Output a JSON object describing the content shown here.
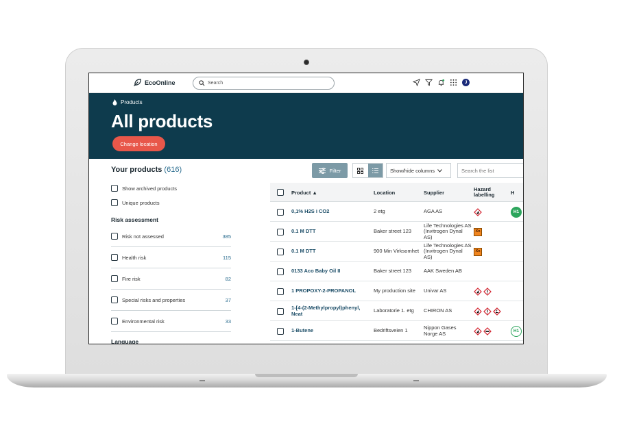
{
  "app": {
    "brand": "EcoOnline",
    "search_placeholder": "Search",
    "avatar_initial": "J"
  },
  "hero": {
    "breadcrumb": "Products",
    "title": "All products",
    "change_location": "Change location"
  },
  "left": {
    "your_products": "Your products",
    "count": "(616)",
    "show_archived": "Show archived products",
    "unique_products": "Unique products",
    "risk_heading": "Risk assessment",
    "risks": [
      {
        "label": "Risk not assessed",
        "count": "385"
      },
      {
        "label": "Health risk",
        "count": "115"
      },
      {
        "label": "Fire risk",
        "count": "82"
      },
      {
        "label": "Special risks and properties",
        "count": "37"
      },
      {
        "label": "Environmental risk",
        "count": "33"
      }
    ],
    "language_heading": "Language"
  },
  "toolbar": {
    "filter": "Filter",
    "show_hide": "Show/hide columns",
    "search_list": "Search the list"
  },
  "table": {
    "headers": {
      "product": "Product ▲",
      "location": "Location",
      "supplier": "Supplier",
      "hazard": "Hazard labelling",
      "h": "H"
    },
    "rows": [
      {
        "product": "0,1% H2S i CO2",
        "location": "2 etg",
        "supplier": "AGA AS",
        "hazard": [
          "ghs-flame-icon"
        ],
        "h": "H1"
      },
      {
        "product": "0.1 M DTT",
        "location": "Baker street 123",
        "supplier": "Life Technologies AS (Invitrogen Dynal AS)",
        "hazard": [
          "xn-icon"
        ],
        "h": ""
      },
      {
        "product": "0.1 M DTT",
        "location": "900 Min Virksomhet",
        "supplier": "Life Technologies AS (Invitrogen Dynal AS)",
        "hazard": [
          "xn-icon"
        ],
        "h": ""
      },
      {
        "product": "0133 Aco Baby Oil II",
        "location": "Baker street 123",
        "supplier": "AAK Sweden AB",
        "hazard": [],
        "h": ""
      },
      {
        "product": "1 PROPOXY-2-PROPANOL",
        "location": "My production site",
        "supplier": "Univar AS",
        "hazard": [
          "ghs-flame-icon",
          "ghs-exclamation-icon"
        ],
        "h": ""
      },
      {
        "product": "1-[4-(2-Methylpropyl)phenyl, Neat",
        "location": "Laboratorie 1. etg",
        "supplier": "CHIRON AS",
        "hazard": [
          "ghs-flame-icon",
          "ghs-exclamation-icon",
          "ghs-fish-icon"
        ],
        "h": ""
      },
      {
        "product": "1-Butene",
        "location": "Bedriftsveien 1",
        "supplier": "Nippon Gases Norge AS",
        "hazard": [
          "ghs-flame-icon",
          "ghs-gas-icon"
        ],
        "h": "H1"
      }
    ],
    "xn_label": "Xn"
  },
  "colors": {
    "hero_bg": "#0e3b4d",
    "accent_button": "#e8574a",
    "filter_button": "#7c9aa6",
    "badge_green": "#2ca55c",
    "link_blue": "#2b6d8f"
  }
}
